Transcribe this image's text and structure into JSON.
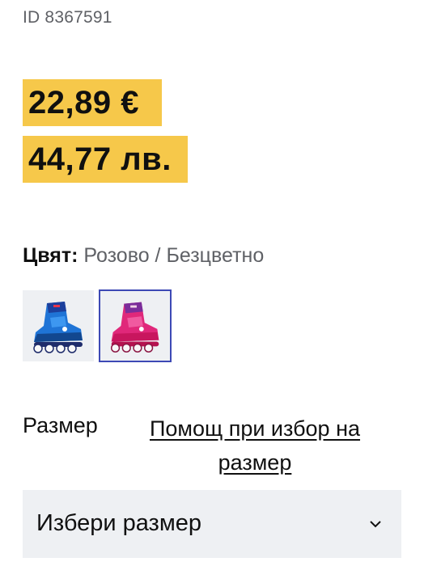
{
  "product": {
    "id_text": "ID 8367591"
  },
  "price": {
    "eur": "22,89 €",
    "bgn": "44,77 лв.",
    "highlight_color": "#f6c84a"
  },
  "color": {
    "label": "Цвят:",
    "value": "Розово / Безцветно",
    "swatches": [
      {
        "name": "blue-inline-skate",
        "selected": false
      },
      {
        "name": "pink-inline-skate",
        "selected": true
      }
    ],
    "selected_border_color": "#3d49b5"
  },
  "size": {
    "label": "Размер",
    "help_link": "Помощ при избор на размер",
    "select_placeholder": "Избери размер",
    "select_icon": "chevron-down-icon"
  }
}
